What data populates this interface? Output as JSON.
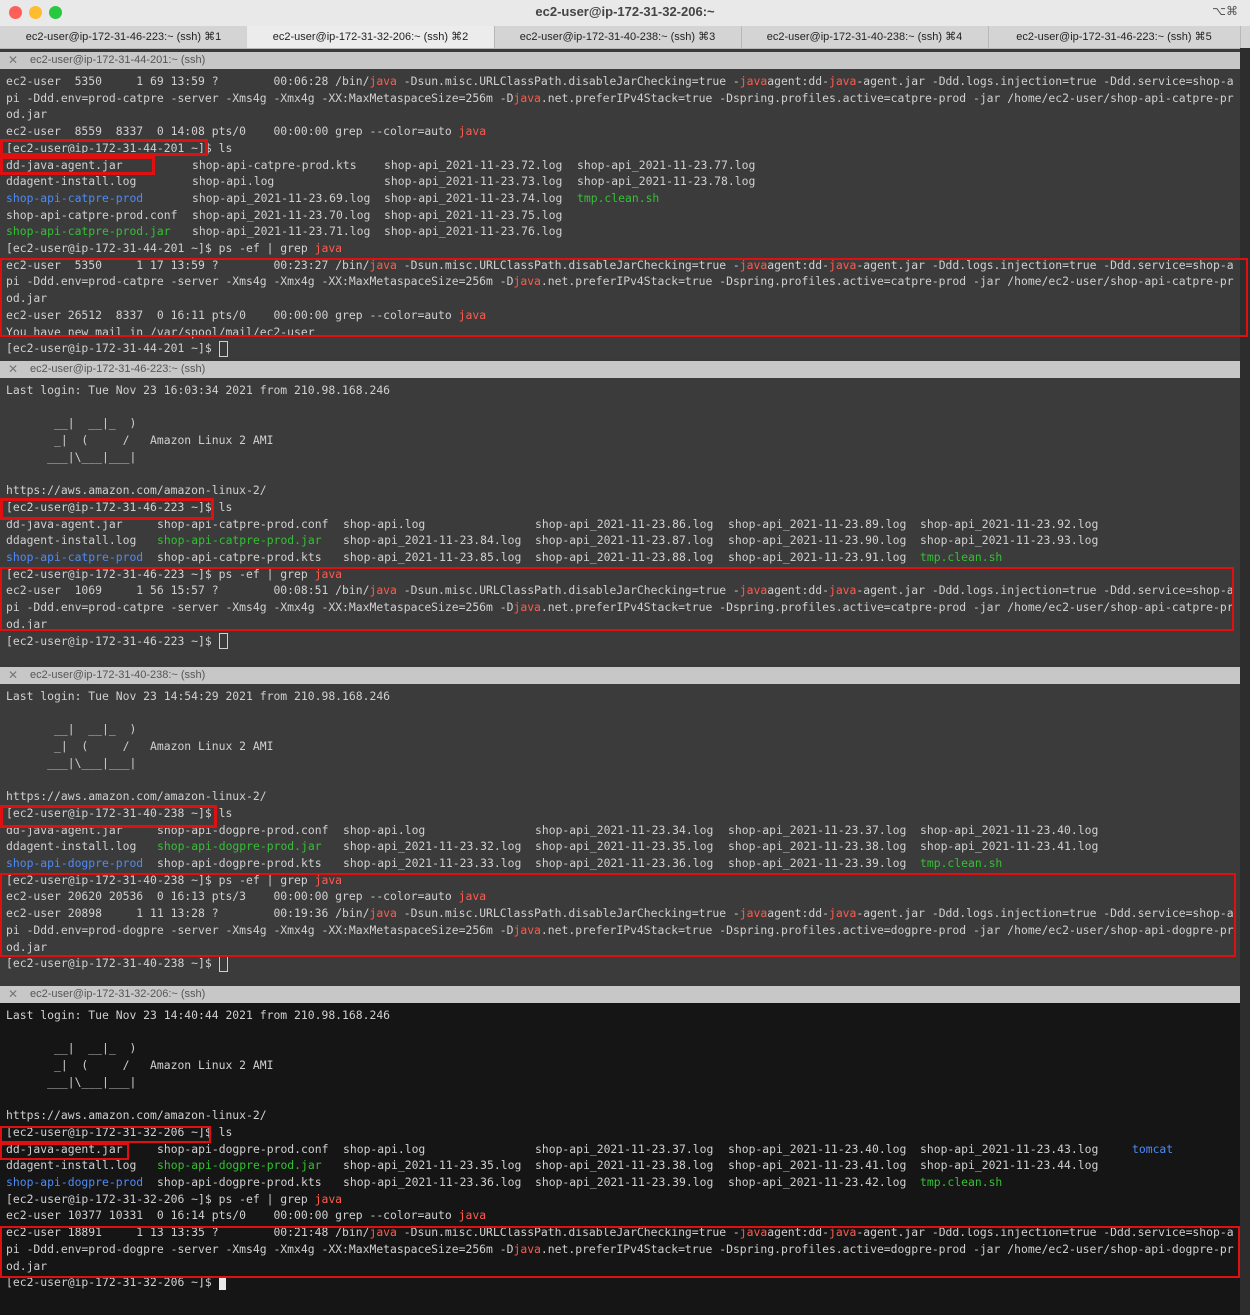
{
  "window": {
    "title": "ec2-user@ip-172-31-32-206:~",
    "shortcut": "⌥⌘"
  },
  "tabs": [
    {
      "label": "ec2-user@ip-172-31-46-223:~ (ssh)  ⌘1"
    },
    {
      "label": "ec2-user@ip-172-31-32-206:~ (ssh)  ⌘2"
    },
    {
      "label": "ec2-user@ip-172-31-40-238:~ (ssh)  ⌘3"
    },
    {
      "label": "ec2-user@ip-172-31-40-238:~ (ssh)  ⌘4"
    },
    {
      "label": "ec2-user@ip-172-31-46-223:~ (ssh)  ⌘5"
    }
  ],
  "panes": [
    {
      "title": "ec2-user@ip-172-31-44-201:~ (ssh)",
      "lines": [
        "ec2-user  5350     1 69 13:59 ?        00:06:28 /bin/java -Dsun.misc.URLClassPath.disableJarChecking=true -javaagent:dd-java-agent.jar -Ddd.logs.injection=true -Ddd.service=shop-a",
        "pi -Ddd.env=prod-catpre -server -Xms4g -Xmx4g -XX:MaxMetaspaceSize=256m -Djava.net.preferIPv4Stack=true -Dspring.profiles.active=catpre-prod -jar /home/ec2-user/shop-api-catpre-pr",
        "od.jar",
        "ec2-user  8559  8337  0 14:08 pts/0    00:00:00 grep --color=auto java",
        "[ec2-user@ip-172-31-44-201 ~]$ ls",
        "",
        "",
        "",
        "",
        "",
        "[ec2-user@ip-172-31-44-201 ~]$ ps -ef | grep java",
        "ec2-user  5350     1 17 13:59 ?        00:23:27 /bin/java -Dsun.misc.URLClassPath.disableJarChecking=true -javaagent:dd-java-agent.jar -Ddd.logs.injection=true -Ddd.service=shop-a",
        "pi -Ddd.env=prod-catpre -server -Xms4g -Xmx4g -XX:MaxMetaspaceSize=256m -Djava.net.preferIPv4Stack=true -Dspring.profiles.active=catpre-prod -jar /home/ec2-user/shop-api-catpre-pr",
        "od.jar",
        "ec2-user 26512  8337  0 16:11 pts/0    00:00:00 grep --color=auto java",
        "You have new mail in /var/spool/mail/ec2-user",
        "[ec2-user@ip-172-31-44-201 ~]$ "
      ],
      "ls_rows": [
        [
          "dd-java-agent.jar",
          "shop-api-catpre-prod.kts",
          "shop-api_2021-11-23.72.log",
          "shop-api_2021-11-23.77.log"
        ],
        [
          "ddagent-install.log",
          "shop-api.log",
          "shop-api_2021-11-23.73.log",
          "shop-api_2021-11-23.78.log"
        ],
        [
          "shop-api-catpre-prod",
          "shop-api_2021-11-23.69.log",
          "shop-api_2021-11-23.74.log",
          "tmp.clean.sh"
        ],
        [
          "shop-api-catpre-prod.conf",
          "shop-api_2021-11-23.70.log",
          "shop-api_2021-11-23.75.log",
          ""
        ],
        [
          "shop-api-catpre-prod.jar",
          "shop-api_2021-11-23.71.log",
          "shop-api_2021-11-23.76.log",
          ""
        ]
      ]
    },
    {
      "title": "ec2-user@ip-172-31-46-223:~ (ssh)",
      "lines": [
        "Last login: Tue Nov 23 16:03:34 2021 from 210.98.168.246",
        "",
        "       __|  __|_  )",
        "       _|  (     /   Amazon Linux 2 AMI",
        "      ___|\\___|___|",
        "",
        "https://aws.amazon.com/amazon-linux-2/",
        "[ec2-user@ip-172-31-46-223 ~]$ ls",
        "",
        "",
        "",
        "[ec2-user@ip-172-31-46-223 ~]$ ps -ef | grep java",
        "ec2-user  1069     1 56 15:57 ?        00:08:51 /bin/java -Dsun.misc.URLClassPath.disableJarChecking=true -javaagent:dd-java-agent.jar -Ddd.logs.injection=true -Ddd.service=shop-a",
        "pi -Ddd.env=prod-catpre -server -Xms4g -Xmx4g -XX:MaxMetaspaceSize=256m -Djava.net.preferIPv4Stack=true -Dspring.profiles.active=catpre-prod -jar /home/ec2-user/shop-api-catpre-pr",
        "od.jar",
        "[ec2-user@ip-172-31-46-223 ~]$ "
      ],
      "ls_rows": [
        [
          "dd-java-agent.jar",
          "shop-api-catpre-prod.conf",
          "shop-api.log",
          "shop-api_2021-11-23.86.log",
          "shop-api_2021-11-23.89.log",
          "shop-api_2021-11-23.92.log"
        ],
        [
          "ddagent-install.log",
          "shop-api-catpre-prod.jar",
          "shop-api_2021-11-23.84.log",
          "shop-api_2021-11-23.87.log",
          "shop-api_2021-11-23.90.log",
          "shop-api_2021-11-23.93.log"
        ],
        [
          "shop-api-catpre-prod",
          "shop-api-catpre-prod.kts",
          "shop-api_2021-11-23.85.log",
          "shop-api_2021-11-23.88.log",
          "shop-api_2021-11-23.91.log",
          "tmp.clean.sh"
        ]
      ]
    },
    {
      "title": "ec2-user@ip-172-31-40-238:~ (ssh)",
      "lines": [
        "Last login: Tue Nov 23 14:54:29 2021 from 210.98.168.246",
        "",
        "       __|  __|_  )",
        "       _|  (     /   Amazon Linux 2 AMI",
        "      ___|\\___|___|",
        "",
        "https://aws.amazon.com/amazon-linux-2/",
        "[ec2-user@ip-172-31-40-238 ~]$ ls",
        "",
        "",
        "",
        "[ec2-user@ip-172-31-40-238 ~]$ ps -ef | grep java",
        "ec2-user 20620 20536  0 16:13 pts/3    00:00:00 grep --color=auto java",
        "ec2-user 20898     1 11 13:28 ?        00:19:36 /bin/java -Dsun.misc.URLClassPath.disableJarChecking=true -javaagent:dd-java-agent.jar -Ddd.logs.injection=true -Ddd.service=shop-a",
        "pi -Ddd.env=prod-dogpre -server -Xms4g -Xmx4g -XX:MaxMetaspaceSize=256m -Djava.net.preferIPv4Stack=true -Dspring.profiles.active=dogpre-prod -jar /home/ec2-user/shop-api-dogpre-pr",
        "od.jar",
        "[ec2-user@ip-172-31-40-238 ~]$ "
      ],
      "ls_rows": [
        [
          "dd-java-agent.jar",
          "shop-api-dogpre-prod.conf",
          "shop-api.log",
          "shop-api_2021-11-23.34.log",
          "shop-api_2021-11-23.37.log",
          "shop-api_2021-11-23.40.log"
        ],
        [
          "ddagent-install.log",
          "shop-api-dogpre-prod.jar",
          "shop-api_2021-11-23.32.log",
          "shop-api_2021-11-23.35.log",
          "shop-api_2021-11-23.38.log",
          "shop-api_2021-11-23.41.log"
        ],
        [
          "shop-api-dogpre-prod",
          "shop-api-dogpre-prod.kts",
          "shop-api_2021-11-23.33.log",
          "shop-api_2021-11-23.36.log",
          "shop-api_2021-11-23.39.log",
          "tmp.clean.sh"
        ]
      ]
    },
    {
      "title": "ec2-user@ip-172-31-32-206:~ (ssh)",
      "lines": [
        "Last login: Tue Nov 23 14:40:44 2021 from 210.98.168.246",
        "",
        "       __|  __|_  )",
        "       _|  (     /   Amazon Linux 2 AMI",
        "      ___|\\___|___|",
        "",
        "https://aws.amazon.com/amazon-linux-2/",
        "[ec2-user@ip-172-31-32-206 ~]$ ls",
        "",
        "",
        "",
        "[ec2-user@ip-172-31-32-206 ~]$ ps -ef | grep java",
        "ec2-user 10377 10331  0 16:14 pts/0    00:00:00 grep --color=auto java",
        "ec2-user 18891     1 13 13:35 ?        00:21:48 /bin/java -Dsun.misc.URLClassPath.disableJarChecking=true -javaagent:dd-java-agent.jar -Ddd.logs.injection=true -Ddd.service=shop-a",
        "pi -Ddd.env=prod-dogpre -server -Xms4g -Xmx4g -XX:MaxMetaspaceSize=256m -Djava.net.preferIPv4Stack=true -Dspring.profiles.active=dogpre-prod -jar /home/ec2-user/shop-api-dogpre-pr",
        "od.jar",
        "[ec2-user@ip-172-31-32-206 ~]$ "
      ],
      "ls_rows": [
        [
          "dd-java-agent.jar",
          "shop-api-dogpre-prod.conf",
          "shop-api.log",
          "shop-api_2021-11-23.37.log",
          "shop-api_2021-11-23.40.log",
          "shop-api_2021-11-23.43.log",
          "tomcat"
        ],
        [
          "ddagent-install.log",
          "shop-api-dogpre-prod.jar",
          "shop-api_2021-11-23.35.log",
          "shop-api_2021-11-23.38.log",
          "shop-api_2021-11-23.41.log",
          "shop-api_2021-11-23.44.log",
          ""
        ],
        [
          "shop-api-dogpre-prod",
          "shop-api-dogpre-prod.kts",
          "shop-api_2021-11-23.36.log",
          "shop-api_2021-11-23.39.log",
          "shop-api_2021-11-23.42.log",
          "tmp.clean.sh",
          ""
        ]
      ]
    }
  ],
  "colors": {
    "java_highlight": "#ff5b4e",
    "directory": "#4d8bf5",
    "executable": "#33c133",
    "annotation_box": "#e01010"
  }
}
